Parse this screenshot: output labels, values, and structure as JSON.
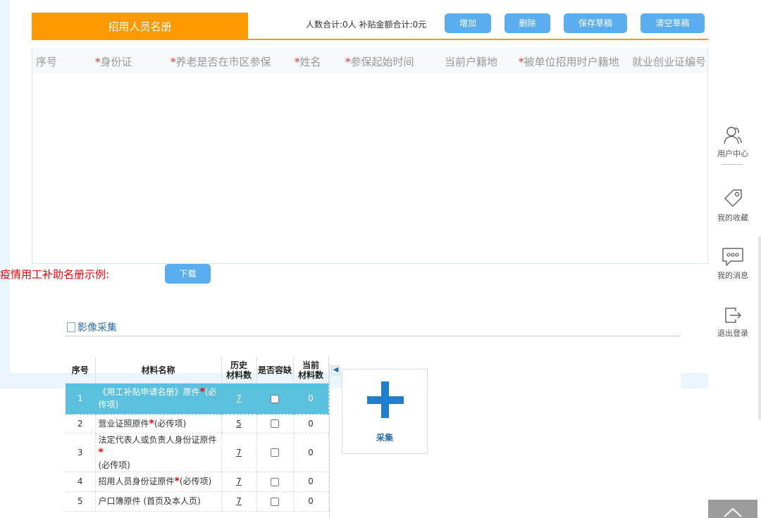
{
  "roster": {
    "tab_title": "招用人员名册",
    "summary": "人数合计:0人  补贴金额合计:0元",
    "buttons": {
      "add": "增加",
      "delete": "删除",
      "save_draft": "保存草稿",
      "clear_draft": "清空草稿"
    },
    "columns": [
      {
        "label": "序号",
        "required": false
      },
      {
        "label": "身份证",
        "required": true
      },
      {
        "label": "养老是否在市区参保",
        "required": true
      },
      {
        "label": "姓名",
        "required": true
      },
      {
        "label": "参保起始时间",
        "required": true
      },
      {
        "label": "当前户籍地",
        "required": false
      },
      {
        "label": "被单位招用时户籍地",
        "required": true
      },
      {
        "label": "就业创业证编号",
        "required": false
      }
    ],
    "required_mark": "*"
  },
  "sample": {
    "label": "疫情用工补助名册示例:",
    "download": "下载"
  },
  "image_collection": {
    "title": "影像采集",
    "headers": {
      "index": "序号",
      "name": "材料名称",
      "history_line1": "历史",
      "history_line2": "材料数",
      "tolerate": "是否容缺",
      "current_line1": "当前",
      "current_line2": "材料数"
    },
    "rows": [
      {
        "index": "1",
        "name_before": "《用工补贴申请名册》原件",
        "name_after": "(必传项)",
        "required": true,
        "history": "7",
        "current": "0",
        "selected": true
      },
      {
        "index": "2",
        "name_before": "营业证照原件",
        "name_after": "(必传项)",
        "required": true,
        "history": "5",
        "current": "0",
        "selected": false
      },
      {
        "index": "3",
        "name_before": "法定代表人或负责人身份证原件",
        "name_after": "(必传项)",
        "required": true,
        "history": "7",
        "current": "0",
        "selected": false
      },
      {
        "index": "4",
        "name_before": "招用人员身份证原件",
        "name_after": "(必传项)",
        "required": true,
        "history": "7",
        "current": "0",
        "selected": false
      },
      {
        "index": "5",
        "name_before": "户口簿原件 (首页及本人页)",
        "name_after": "",
        "required": false,
        "history": "7",
        "current": "0",
        "selected": false
      }
    ],
    "collect_label": "采集"
  },
  "right_rail": {
    "user_center": "用户中心",
    "favorites": "我的收藏",
    "messages": "我的消息",
    "logout": "退出登录"
  },
  "colors": {
    "brand_orange": "#ff9900",
    "button_blue": "#5aaeef",
    "selected_row": "#5bc0de",
    "required_red": "#e33333"
  }
}
